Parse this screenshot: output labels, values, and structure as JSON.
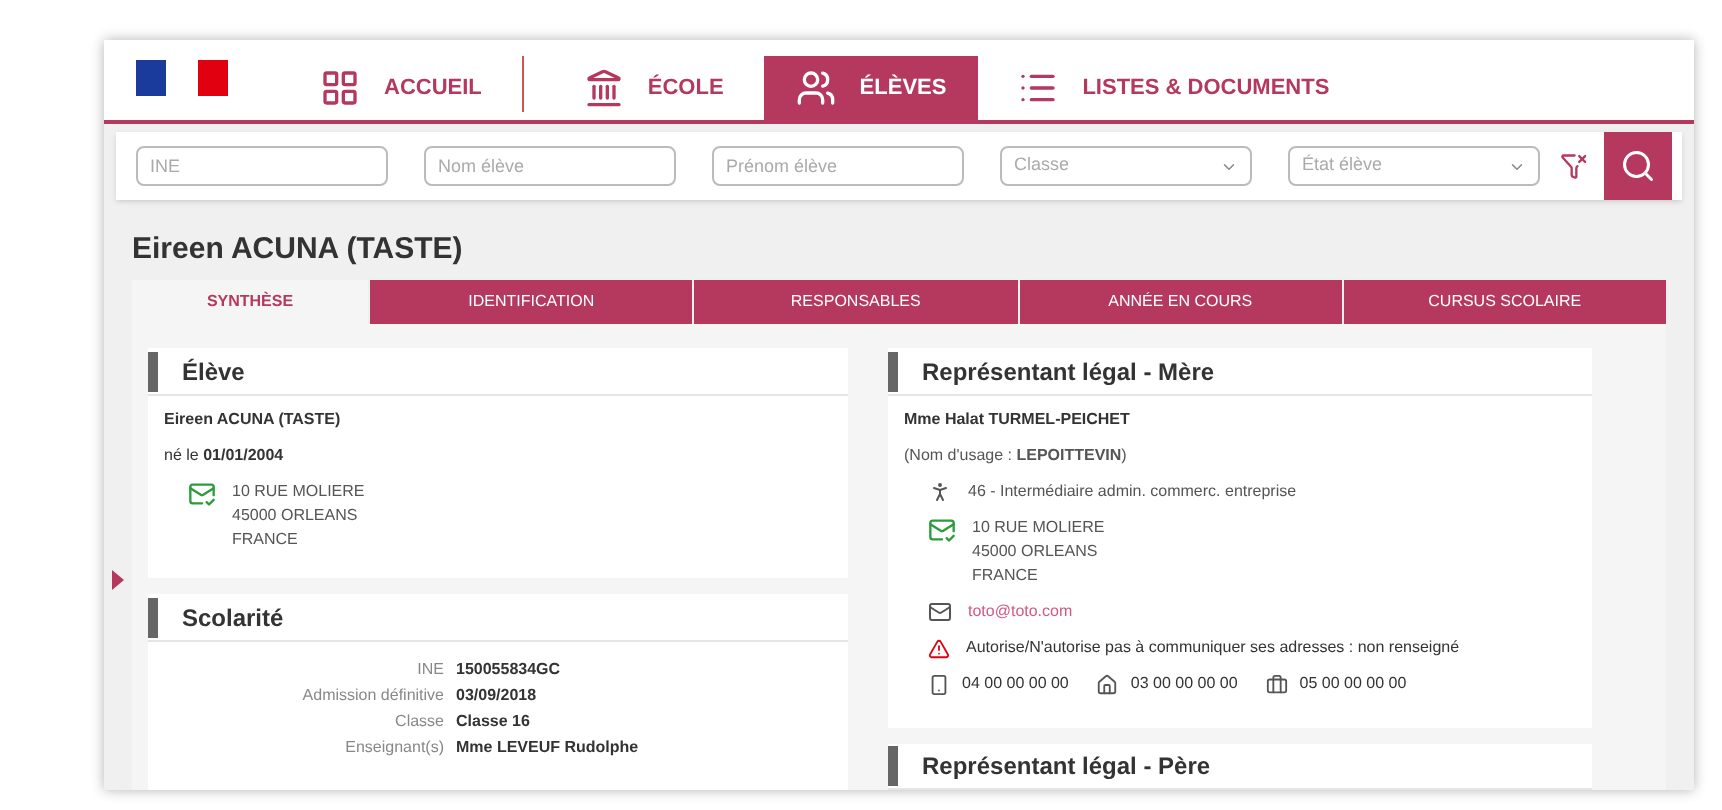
{
  "nav": {
    "items": [
      {
        "label": "ACCUEIL",
        "selected": false
      },
      {
        "label": "ÉCOLE",
        "selected": false
      },
      {
        "label": "ÉLÈVES",
        "selected": true
      },
      {
        "label": "LISTES & DOCUMENTS",
        "selected": false
      }
    ]
  },
  "search": {
    "fields": [
      {
        "kind": "text",
        "placeholder": "INE"
      },
      {
        "kind": "text",
        "placeholder": "Nom élève"
      },
      {
        "kind": "text",
        "placeholder": "Prénom élève"
      },
      {
        "kind": "select",
        "placeholder": "Classe"
      },
      {
        "kind": "select",
        "placeholder": "État élève"
      }
    ]
  },
  "student_title": "Eireen ACUNA (TASTE)",
  "tabs": [
    {
      "label": "SYNTHÈSE",
      "selected": true
    },
    {
      "label": "IDENTIFICATION",
      "selected": false
    },
    {
      "label": "RESPONSABLES",
      "selected": false
    },
    {
      "label": "ANNÉE EN COURS",
      "selected": false
    },
    {
      "label": "CURSUS SCOLAIRE",
      "selected": false
    }
  ],
  "eleve": {
    "title": "Élève",
    "name": "Eireen ACUNA (TASTE)",
    "birth": "né le **01/01/2004**",
    "address": [
      "10 RUE MOLIERE",
      "45000 ORLEANS",
      "FRANCE"
    ]
  },
  "scolarite": {
    "title": "Scolarité",
    "rows": [
      {
        "label": "INE",
        "value": "150055834GC"
      },
      {
        "label": "Admission définitive",
        "value": "03/09/2018"
      },
      {
        "label": "Classe",
        "value": "Classe 16"
      },
      {
        "label": "Enseignant(s)",
        "value": "Mme LEVEUF Rudolphe"
      }
    ]
  },
  "mere": {
    "title": "Représentant légal - Mère",
    "name": "Mme Halat TURMEL-PEICHET",
    "usage": "(Nom d'usage : **LEPOITTEVIN**)",
    "profession": "46 - Intermédiaire admin. commerc. entreprise",
    "address": [
      "10 RUE MOLIERE",
      "45000 ORLEANS",
      "FRANCE"
    ],
    "email": "toto@toto.com",
    "warning": "Autorise/N'autorise pas à communiquer ses adresses : non renseigné",
    "phones": [
      "04 00 00 00 00",
      "03 00 00 00 00",
      "05 00 00 00 00"
    ]
  },
  "next_panel": {
    "title": "Représentant légal - Père"
  }
}
